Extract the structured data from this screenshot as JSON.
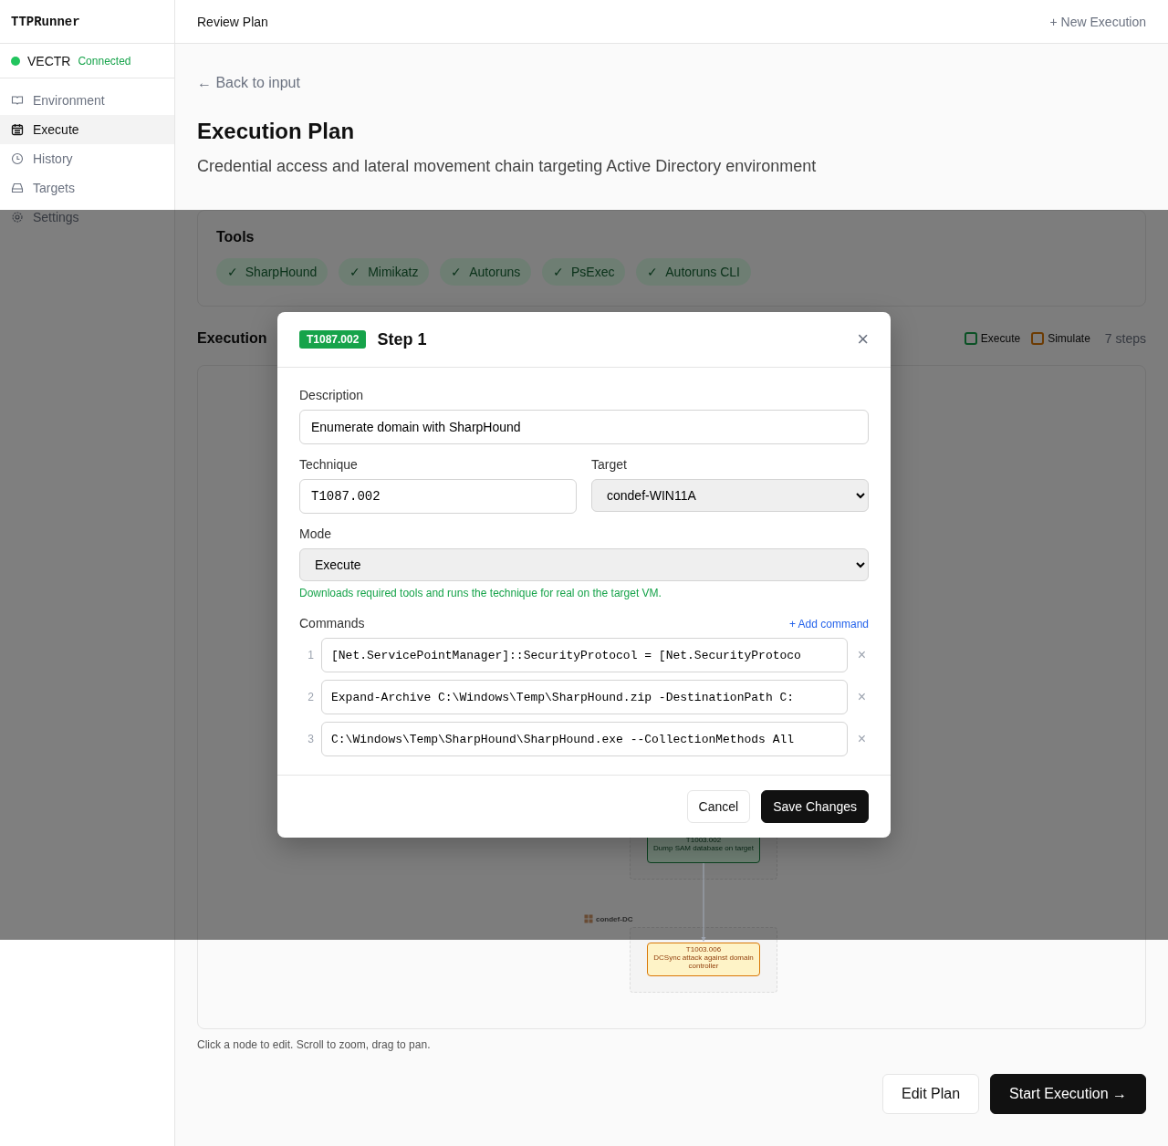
{
  "app": {
    "name": "TTPRunner"
  },
  "connection": {
    "name": "VECTR",
    "status": "Connected",
    "color": "#22c55e"
  },
  "nav": [
    {
      "label": "Environment",
      "selected": false
    },
    {
      "label": "Execute",
      "selected": true
    },
    {
      "label": "History",
      "selected": false
    },
    {
      "label": "Targets",
      "selected": false
    },
    {
      "label": "Settings",
      "selected": false
    }
  ],
  "topbar": {
    "title": "Review Plan",
    "action": "+ New Execution"
  },
  "back_link": "← Back to input",
  "plan": {
    "title": "Execution Plan",
    "subtitle": "Credential access and lateral movement chain targeting Active Directory environment"
  },
  "tools": {
    "title": "Tools",
    "items": [
      "SharpHound",
      "Mimikatz",
      "Autoruns",
      "PsExec",
      "Autoruns CLI"
    ],
    "mark": "✓"
  },
  "graph": {
    "title": "Execution",
    "legend": [
      {
        "label": "Execute",
        "color": "#0b5125"
      },
      {
        "label": "Simulate",
        "color": "#6c3b03"
      }
    ],
    "count": "7 steps",
    "groups": [
      {
        "nodes": [
          {
            "technique": "T1003.002",
            "label": "Dump SAM database on target",
            "kind": "execute"
          }
        ]
      },
      {
        "label": "condef-DC",
        "nodes": [
          {
            "technique": "T1003.006",
            "label": "DCSync attack against domain controller",
            "kind": "simulate"
          }
        ]
      }
    ],
    "caption": "Click a node to edit. Scroll to zoom, drag to pan."
  },
  "actions": {
    "edit": "Edit Plan",
    "start": "Start Execution →"
  },
  "modal": {
    "badge": "T1087.002",
    "title": "Step 1",
    "close": "×",
    "description": {
      "label": "Description",
      "value": "Enumerate domain with SharpHound"
    },
    "technique": {
      "label": "Technique",
      "value": "T1087.002"
    },
    "target": {
      "label": "Target",
      "value": "condef-WIN11A"
    },
    "mode": {
      "label": "Mode",
      "value": "Execute",
      "hint": "Downloads required tools and runs the technique for real on the target VM."
    },
    "commands": {
      "label": "Commands",
      "add": "+ Add command",
      "remove": "×",
      "items": [
        {
          "number": "1",
          "value": "[Net.ServicePointManager]::SecurityProtocol = [Net.SecurityProtoco"
        },
        {
          "number": "2",
          "value": "Expand-Archive C:\\Windows\\Temp\\SharpHound.zip -DestinationPath C:"
        },
        {
          "number": "3",
          "value": "C:\\Windows\\Temp\\SharpHound\\SharpHound.exe --CollectionMethods All"
        }
      ]
    },
    "cancel": "Cancel",
    "save": "Save Changes"
  }
}
